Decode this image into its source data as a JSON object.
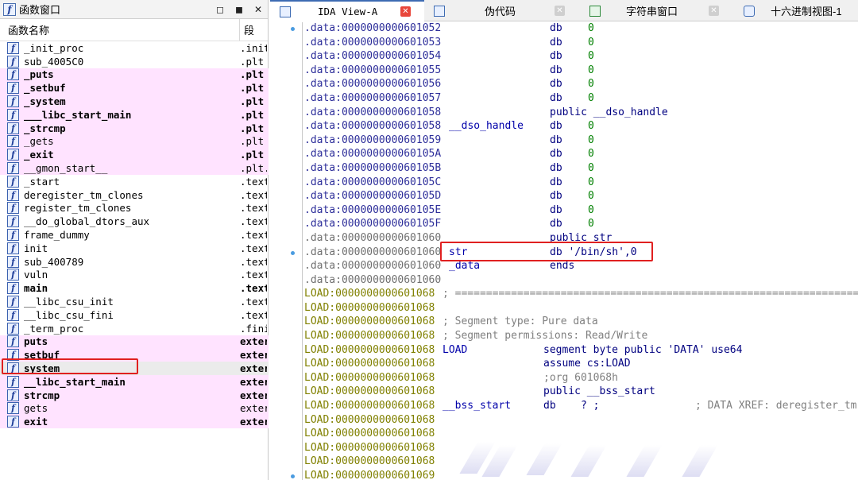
{
  "functions_window": {
    "title": "函数窗口",
    "controls": [
      "◻",
      "◼",
      "✕"
    ],
    "column_name": "函数名称",
    "column_segment": "段",
    "rows": [
      {
        "name": "_init_proc",
        "seg": ".init",
        "pink": false,
        "bold": false
      },
      {
        "name": "sub_4005C0",
        "seg": ".plt",
        "pink": false,
        "bold": false
      },
      {
        "name": "_puts",
        "seg": ".plt",
        "pink": true,
        "bold": true
      },
      {
        "name": "_setbuf",
        "seg": ".plt",
        "pink": true,
        "bold": true
      },
      {
        "name": "_system",
        "seg": ".plt",
        "pink": true,
        "bold": true
      },
      {
        "name": "___libc_start_main",
        "seg": ".plt",
        "pink": true,
        "bold": true
      },
      {
        "name": "_strcmp",
        "seg": ".plt",
        "pink": true,
        "bold": true
      },
      {
        "name": "_gets",
        "seg": ".plt",
        "pink": true,
        "bold": false
      },
      {
        "name": "_exit",
        "seg": ".plt",
        "pink": true,
        "bold": true
      },
      {
        "name": "__gmon_start__",
        "seg": ".plt.",
        "pink": true,
        "bold": false
      },
      {
        "name": "_start",
        "seg": ".text",
        "pink": false,
        "bold": false
      },
      {
        "name": "deregister_tm_clones",
        "seg": ".text",
        "pink": false,
        "bold": false
      },
      {
        "name": "register_tm_clones",
        "seg": ".text",
        "pink": false,
        "bold": false
      },
      {
        "name": "__do_global_dtors_aux",
        "seg": ".text",
        "pink": false,
        "bold": false
      },
      {
        "name": "frame_dummy",
        "seg": ".text",
        "pink": false,
        "bold": false
      },
      {
        "name": "init",
        "seg": ".text",
        "pink": false,
        "bold": false
      },
      {
        "name": "sub_400789",
        "seg": ".text",
        "pink": false,
        "bold": false
      },
      {
        "name": "vuln",
        "seg": ".text",
        "pink": false,
        "bold": false
      },
      {
        "name": "main",
        "seg": ".text",
        "pink": false,
        "bold": true
      },
      {
        "name": "__libc_csu_init",
        "seg": ".text",
        "pink": false,
        "bold": false
      },
      {
        "name": "__libc_csu_fini",
        "seg": ".text",
        "pink": false,
        "bold": false
      },
      {
        "name": "_term_proc",
        "seg": ".fini",
        "pink": false,
        "bold": false
      },
      {
        "name": "puts",
        "seg": "exter",
        "pink": true,
        "bold": true
      },
      {
        "name": "setbuf",
        "seg": "exter",
        "pink": true,
        "bold": true
      },
      {
        "name": "system",
        "seg": "exter",
        "pink": false,
        "bold": true,
        "selected": true
      },
      {
        "name": "__libc_start_main",
        "seg": "exter",
        "pink": true,
        "bold": true
      },
      {
        "name": "strcmp",
        "seg": "exter",
        "pink": true,
        "bold": true
      },
      {
        "name": "gets",
        "seg": "exter",
        "pink": true,
        "bold": false
      },
      {
        "name": "exit",
        "seg": "exter",
        "pink": true,
        "bold": true
      }
    ]
  },
  "tabs": [
    {
      "label": "IDA View-A",
      "active": true
    },
    {
      "label": "伪代码",
      "active": false
    },
    {
      "label": "字符串窗口",
      "active": false
    },
    {
      "label": "十六进制视图-1",
      "active": false
    }
  ],
  "disasm": {
    "lines": [
      {
        "addr": ".data:0000000000601052",
        "label": "",
        "op": "db",
        "arg": "0",
        "dot": true
      },
      {
        "addr": ".data:0000000000601053",
        "label": "",
        "op": "db",
        "arg": "0",
        "dot": false
      },
      {
        "addr": ".data:0000000000601054",
        "label": "",
        "op": "db",
        "arg": "0",
        "dot": false
      },
      {
        "addr": ".data:0000000000601055",
        "label": "",
        "op": "db",
        "arg": "0",
        "dot": false
      },
      {
        "addr": ".data:0000000000601056",
        "label": "",
        "op": "db",
        "arg": "0",
        "dot": false
      },
      {
        "addr": ".data:0000000000601057",
        "label": "",
        "op": "db",
        "arg": "0",
        "dot": false
      },
      {
        "addr": ".data:0000000000601058",
        "label": "",
        "op": "public __dso_handle",
        "arg": "",
        "dot": false
      },
      {
        "addr": ".data:0000000000601058",
        "label": "__dso_handle",
        "op": "db",
        "arg": "0",
        "dot": false
      },
      {
        "addr": ".data:0000000000601059",
        "label": "",
        "op": "db",
        "arg": "0",
        "dot": false
      },
      {
        "addr": ".data:000000000060105A",
        "label": "",
        "op": "db",
        "arg": "0",
        "dot": false
      },
      {
        "addr": ".data:000000000060105B",
        "label": "",
        "op": "db",
        "arg": "0",
        "dot": false
      },
      {
        "addr": ".data:000000000060105C",
        "label": "",
        "op": "db",
        "arg": "0",
        "dot": false
      },
      {
        "addr": ".data:000000000060105D",
        "label": "",
        "op": "db",
        "arg": "0",
        "dot": false
      },
      {
        "addr": ".data:000000000060105E",
        "label": "",
        "op": "db",
        "arg": "0",
        "dot": false
      },
      {
        "addr": ".data:000000000060105F",
        "label": "",
        "op": "db",
        "arg": "0",
        "dot": false
      },
      {
        "addr": ".data:0000000000601060",
        "label": "",
        "op": "public str",
        "arg": "",
        "dot": false
      },
      {
        "addr": ".data:0000000000601060",
        "label": "str",
        "op": "db '/bin/sh',0",
        "arg": "",
        "dot": true
      },
      {
        "addr": ".data:0000000000601060",
        "label": "_data",
        "op": "ends",
        "arg": "",
        "dot": false
      },
      {
        "addr": ".data:0000000000601060",
        "label": "",
        "op": "",
        "arg": "",
        "dot": false
      },
      {
        "addr": "LOAD:0000000000601068",
        "label": "",
        "op": "; =================================================================",
        "arg": "",
        "dot": false,
        "load": true,
        "comment": true
      },
      {
        "addr": "LOAD:0000000000601068",
        "label": "",
        "op": "",
        "arg": "",
        "dot": false,
        "load": true
      },
      {
        "addr": "LOAD:0000000000601068",
        "label": "",
        "op": "; Segment type: Pure data",
        "arg": "",
        "dot": false,
        "load": true,
        "comment": true
      },
      {
        "addr": "LOAD:0000000000601068",
        "label": "",
        "op": "; Segment permissions: Read/Write",
        "arg": "",
        "dot": false,
        "load": true,
        "comment": true
      },
      {
        "addr": "LOAD:0000000000601068",
        "label": "LOAD",
        "op": "segment byte public 'DATA' use64",
        "arg": "",
        "dot": false,
        "load": true
      },
      {
        "addr": "LOAD:0000000000601068",
        "label": "",
        "op": "assume cs:LOAD",
        "arg": "",
        "dot": false,
        "load": true
      },
      {
        "addr": "LOAD:0000000000601068",
        "label": "",
        "op": ";org 601068h",
        "arg": "",
        "dot": false,
        "load": true,
        "comment": true
      },
      {
        "addr": "LOAD:0000000000601068",
        "label": "",
        "op": "public __bss_start",
        "arg": "",
        "dot": false,
        "load": true
      },
      {
        "addr": "LOAD:0000000000601068",
        "label": "__bss_start",
        "op": "db    ? ;",
        "arg": "; DATA XREF: deregister_tm",
        "dot": false,
        "load": true
      },
      {
        "addr": "LOAD:0000000000601068",
        "label": "",
        "op": "",
        "arg": "",
        "dot": false,
        "load": true
      },
      {
        "addr": "LOAD:0000000000601068",
        "label": "",
        "op": "",
        "arg": "",
        "dot": false,
        "load": true
      },
      {
        "addr": "LOAD:0000000000601068",
        "label": "",
        "op": "",
        "arg": "",
        "dot": false,
        "load": true
      },
      {
        "addr": "LOAD:0000000000601068",
        "label": "",
        "op": "",
        "arg": "",
        "dot": false,
        "load": true
      },
      {
        "addr": "LOAD:0000000000601069",
        "label": "",
        "op": "",
        "arg": "",
        "dot": true,
        "load": true
      }
    ]
  }
}
